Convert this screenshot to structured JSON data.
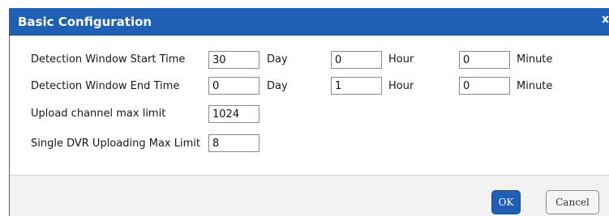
{
  "dialog": {
    "title": "Basic Configuration",
    "close_glyph": "x"
  },
  "fields": {
    "start_time": {
      "label": "Detection Window Start Time",
      "day_value": "30",
      "day_unit": "Day",
      "hour_value": "0",
      "hour_unit": "Hour",
      "minute_value": "0",
      "minute_unit": "Minute"
    },
    "end_time": {
      "label": "Detection Window End Time",
      "day_value": "0",
      "day_unit": "Day",
      "hour_value": "1",
      "hour_unit": "Hour",
      "minute_value": "0",
      "minute_unit": "Minute"
    },
    "upload_channel": {
      "label": "Upload channel max limit",
      "value": "1024"
    },
    "single_dvr": {
      "label": "Single DVR Uploading Max Limit",
      "value": "8"
    }
  },
  "buttons": {
    "ok": "OK",
    "cancel": "Cancel"
  },
  "colors": {
    "titlebar": "#1f5fb5",
    "ok_button": "#1f5fb5"
  }
}
